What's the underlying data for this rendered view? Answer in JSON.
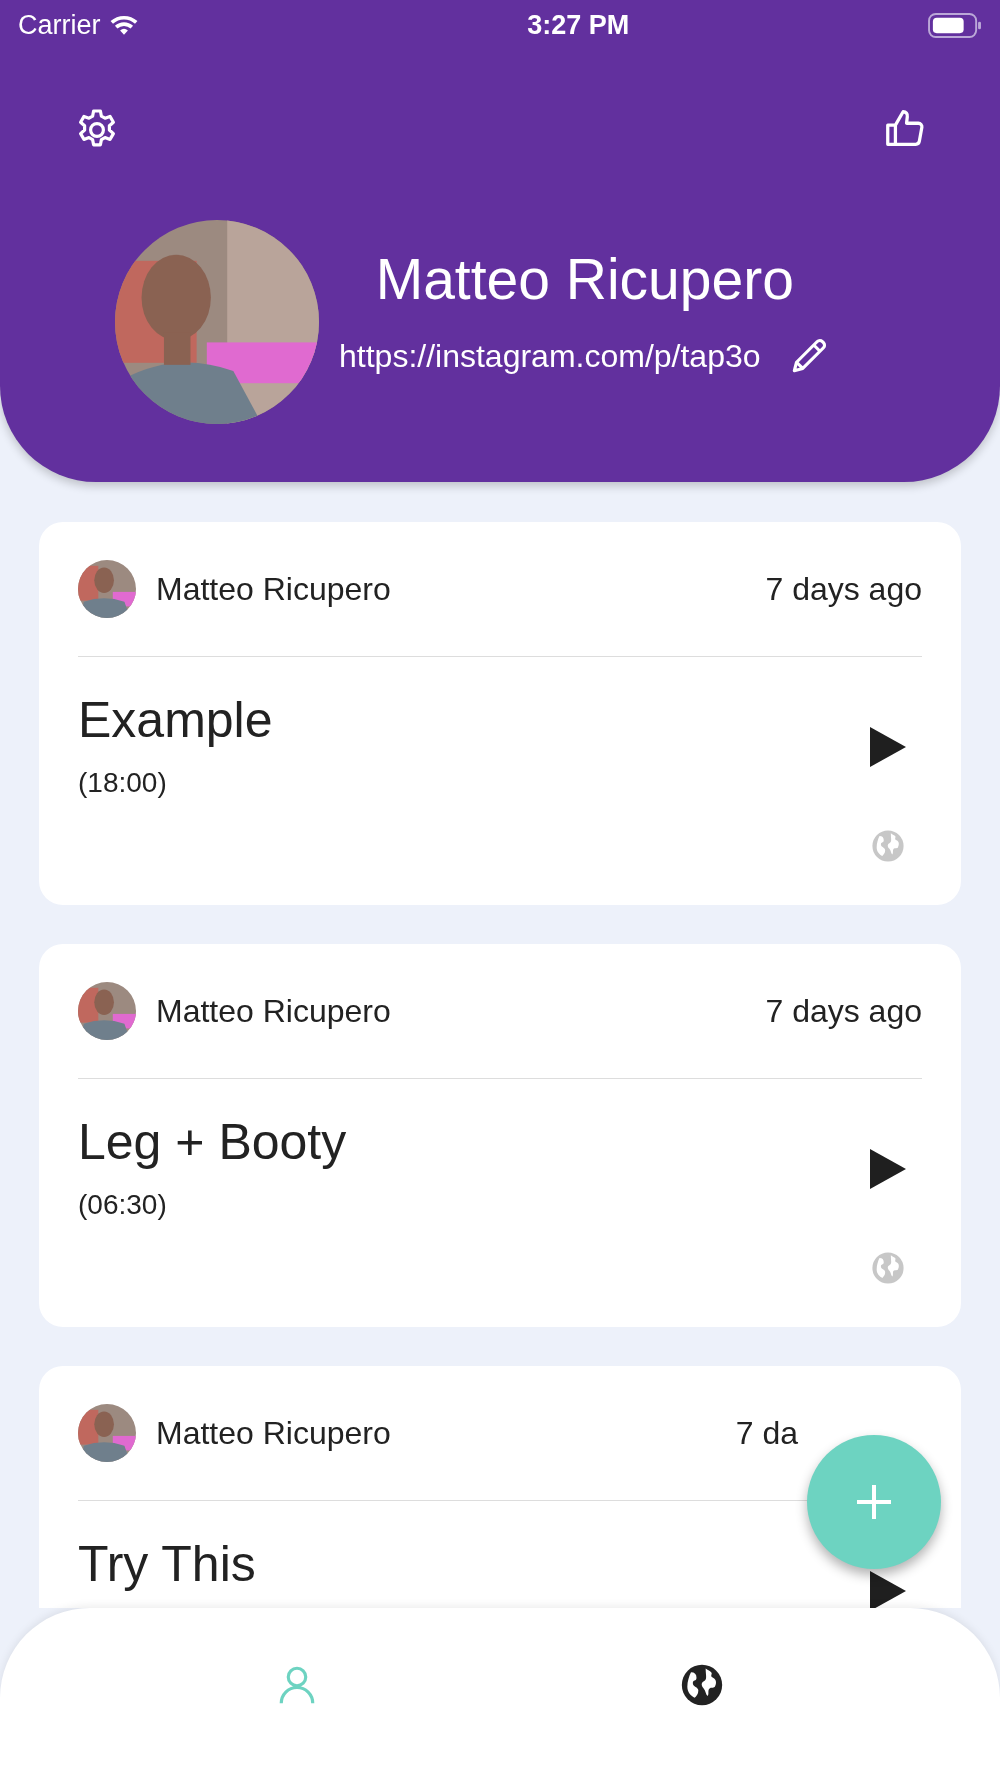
{
  "status_bar": {
    "carrier": "Carrier",
    "time": "3:27 PM"
  },
  "profile": {
    "name": "Matteo Ricupero",
    "link": "https://instagram.com/p/tap3o"
  },
  "posts": [
    {
      "author": "Matteo Ricupero",
      "time": "7 days ago",
      "title": "Example",
      "duration": "(18:00)"
    },
    {
      "author": "Matteo Ricupero",
      "time": "7 days ago",
      "title": "Leg + Booty",
      "duration": "(06:30)"
    },
    {
      "author": "Matteo Ricupero",
      "time": "7 da",
      "title": "Try This"
    }
  ],
  "nav": [
    {
      "kind": "profile",
      "selected": true
    },
    {
      "kind": "world",
      "selected": false
    }
  ]
}
